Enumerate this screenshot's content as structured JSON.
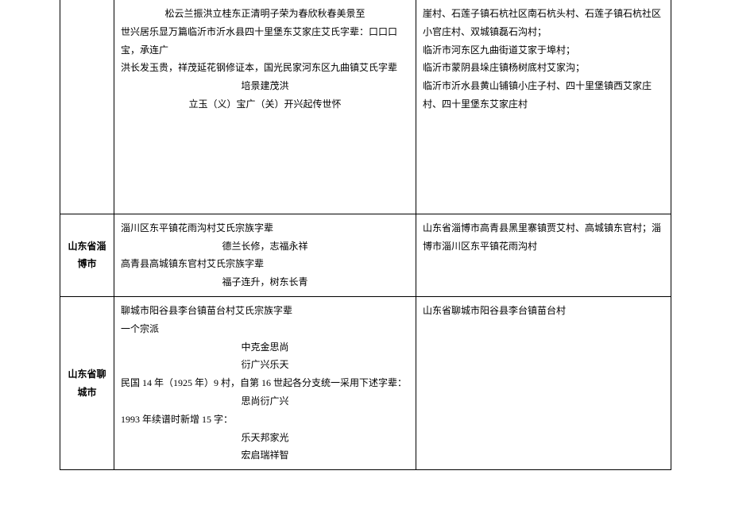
{
  "rows": [
    {
      "region": "",
      "middle": {
        "line1_center": "松云兰振洪立桂东正清明子荣为春欣秋春美景至",
        "line2": "世兴居乐显万篇临沂市沂水县四十里堡东艾家庄艾氏字辈：口口口宝，承连广",
        "line3": "洪长发玉贵，祥茂延花钢修证本，国光民家河东区九曲镇艾氏字辈",
        "line4_center": "培景建茂洪",
        "line5_center": "立玉（义）宝广（关）开兴起传世怀"
      },
      "right": {
        "line1": "崖村、石莲子镇石杭社区南石杭头村、石莲子镇石杭社区小官庄村、双城镇磊石沟村；",
        "line2": "临沂市河东区九曲街道艾家于埠村；",
        "line3": "临沂市蒙阴县垛庄镇杨树底村艾家沟；",
        "line4": "临沂市沂水县黄山铺镇小庄子村、四十里堡镇西艾家庄村、四十里堡东艾家庄村"
      }
    },
    {
      "region": "山东省淄博市",
      "middle": {
        "line1": "淄川区东平镇花雨沟村艾氏宗族字辈",
        "line2_center": "德兰长修，志福永祥",
        "line3": "高青县高城镇东官村艾氏宗族字辈",
        "line4_center": "福子连升，树东长青"
      },
      "right": {
        "line1": "山东省淄博市高青县黑里寨镇贾艾村、高城镇东官村；淄博市淄川区东平镇花雨沟村"
      }
    },
    {
      "region": "山东省聊城市",
      "middle": {
        "line1": "聊城市阳谷县李台镇苗台村艾氏宗族字辈",
        "line2": "一个宗派",
        "line3_center": "中克金思尚",
        "line4_center": "衍广兴乐天",
        "line5": "民国 14 年（1925 年）9 村，自第 16 世起各分支统一采用下述字辈：",
        "line6_center": "思尚衍广兴",
        "line7": "1993 年续谱时新增 15 字：",
        "line8_center": "乐天邦家光",
        "line9_center": "宏启瑞祥智"
      },
      "right": {
        "line1": "山东省聊城市阳谷县李台镇苗台村"
      }
    }
  ]
}
